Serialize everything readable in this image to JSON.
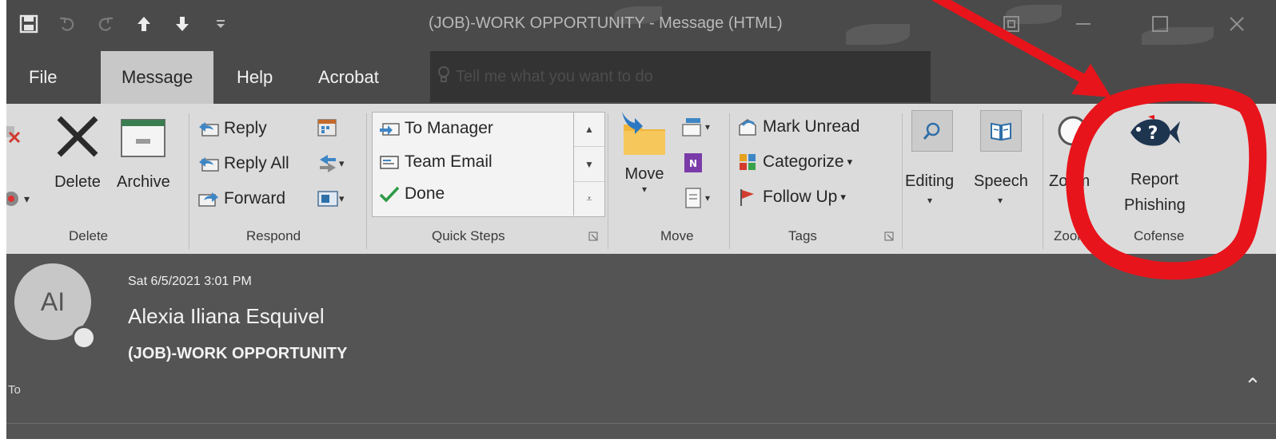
{
  "window": {
    "title": "(JOB)-WORK OPPORTUNITY  -  Message (HTML)",
    "quick_access": [
      "save-icon",
      "undo-icon",
      "redo-icon",
      "up-arrow-icon",
      "down-arrow-icon",
      "customize-qat-icon"
    ],
    "controls": [
      "restore-icon",
      "minimize-icon",
      "maximize-icon",
      "close-icon"
    ]
  },
  "tabs": [
    {
      "label": "File"
    },
    {
      "label": "Message",
      "active": true
    },
    {
      "label": "Help"
    },
    {
      "label": "Acrobat"
    }
  ],
  "tell_me": {
    "placeholder": "Tell me what you want to do"
  },
  "ribbon": {
    "delete_group": {
      "delete_label": "Delete",
      "archive_label": "Archive",
      "group_label": "Delete"
    },
    "respond_group": {
      "reply": "Reply",
      "reply_all": "Reply All",
      "forward": "Forward",
      "group_label": "Respond"
    },
    "quick_steps_group": {
      "items": [
        "To Manager",
        "Team Email",
        "Done"
      ],
      "group_label": "Quick Steps"
    },
    "move_group": {
      "move_label": "Move",
      "group_label": "Move"
    },
    "tags_group": {
      "mark_unread": "Mark Unread",
      "categorize": "Categorize",
      "follow_up": "Follow Up",
      "group_label": "Tags"
    },
    "editing_label": "Editing",
    "speech_label": "Speech",
    "zoom_label": "Zoom",
    "zoom_group_label": "Zoom",
    "cofense_group": {
      "button_line1": "Report",
      "button_line2": "Phishing",
      "group_label": "Cofense"
    }
  },
  "message": {
    "avatar_initials": "AI",
    "date": "Sat 6/5/2021 3:01 PM",
    "sender": "Alexia Iliana Esquivel",
    "subject": "(JOB)-WORK OPPORTUNITY",
    "to_label": "To"
  },
  "colors": {
    "annotation": "#e8141b",
    "titlebar": "#4a4a4a",
    "ribbon": "#dbdbdb",
    "header": "#545454"
  }
}
